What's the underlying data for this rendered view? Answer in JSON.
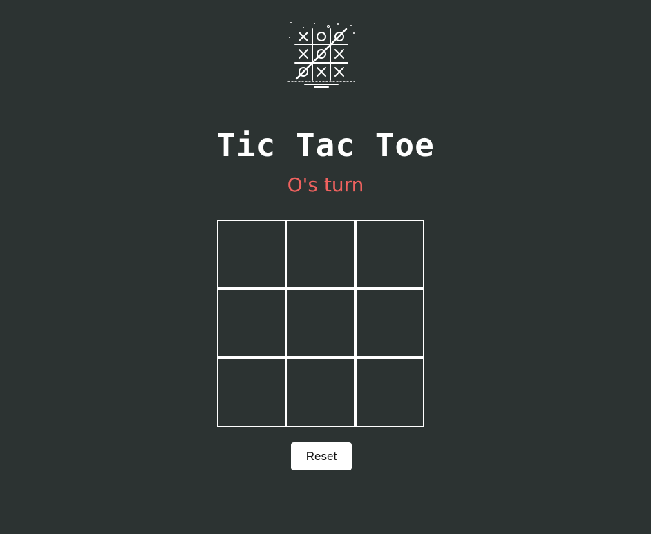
{
  "app": {
    "logo_icon": "tic-tac-toe-board-icon",
    "title": "Tic Tac Toe",
    "status": "O's turn",
    "reset_label": "Reset"
  },
  "board": {
    "cells": [
      "",
      "",
      "",
      "",
      "",
      "",
      "",
      "",
      ""
    ]
  },
  "colors": {
    "background": "#2c3332",
    "status_text": "#f0625f",
    "grid_line": "#ffffff"
  }
}
